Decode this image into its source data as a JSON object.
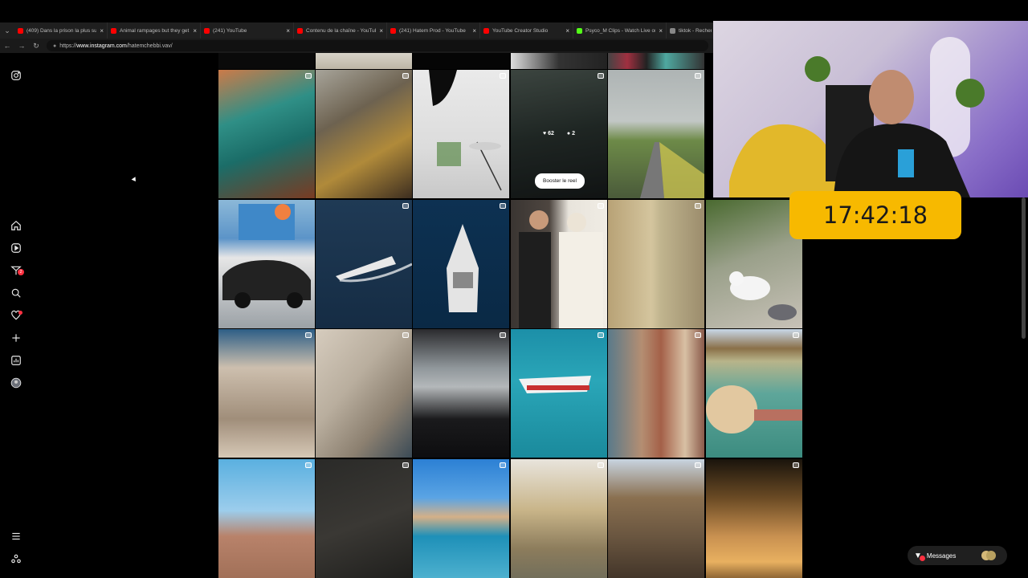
{
  "browser": {
    "tabs": [
      {
        "label": "(409) Dans la prison la plus susp...",
        "color": "#ff0000"
      },
      {
        "label": "Animal rampages but they get...",
        "color": "#ff0000"
      },
      {
        "label": "(241) YouTube",
        "color": "#ff0000"
      },
      {
        "label": "Contenu de la chaîne - YouTube...",
        "color": "#ff0000"
      },
      {
        "label": "(241) Hatem Prod - YouTube",
        "color": "#ff0000"
      },
      {
        "label": "YouTube Creator Studio",
        "color": "#ff0000"
      },
      {
        "label": "Psyco_M Clips - Watch Live on K...",
        "color": "#53fc18"
      },
      {
        "label": "tiktok - Recherche",
        "color": "#888888"
      }
    ],
    "url_prefix": "https://",
    "url_host": "www.instagram.com",
    "url_path": "/hatemchebbi.vav/"
  },
  "sidebar": {
    "icons": [
      "instagram-icon",
      "home-icon",
      "reels-icon",
      "messenger-icon",
      "search-icon",
      "heart-icon",
      "create-icon",
      "dashboard-icon",
      "profile-avatar",
      "menu-icon",
      "threads-icon"
    ],
    "messenger_badge": "2"
  },
  "grid": {
    "hovered_post": {
      "likes": "62",
      "comments": "2",
      "boost_label": "Booster le reel"
    }
  },
  "overlay": {
    "timer": "17:42:18"
  },
  "messages": {
    "label": "Messages"
  }
}
